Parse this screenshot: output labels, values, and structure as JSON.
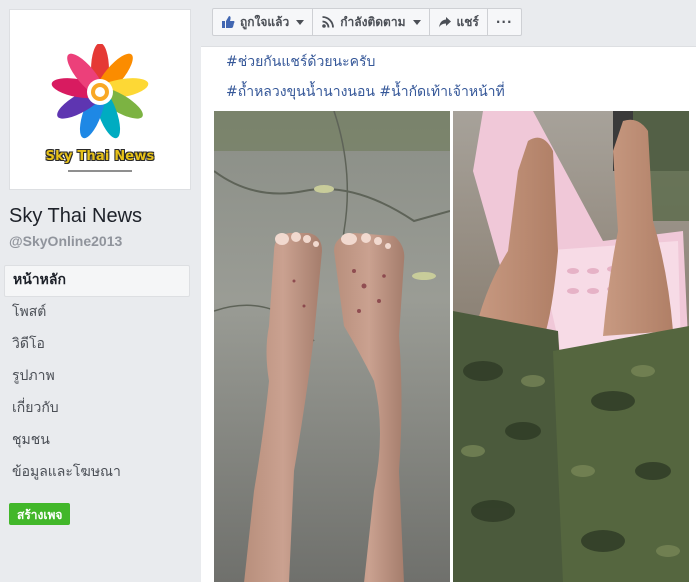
{
  "sidebar": {
    "logo_text": "Sky Thai News",
    "page_name": "Sky Thai News",
    "page_handle": "@SkyOnline2013",
    "nav_items": [
      {
        "label": "หน้าหลัก",
        "active": true
      },
      {
        "label": "โพสต์",
        "active": false
      },
      {
        "label": "วิดีโอ",
        "active": false
      },
      {
        "label": "รูปภาพ",
        "active": false
      },
      {
        "label": "เกี่ยวกับ",
        "active": false
      },
      {
        "label": "ชุมชน",
        "active": false
      },
      {
        "label": "ข้อมูลและโฆษณา",
        "active": false
      }
    ],
    "create_page_label": "สร้างเพจ"
  },
  "toolbar": {
    "like_label": "ถูกใจแล้ว",
    "follow_label": "กำลังติดตาม",
    "share_label": "แชร์",
    "more_label": "···"
  },
  "post": {
    "line1": "#ช่วยกันแชร์ด้วยนะครับ",
    "line2": "#ถ้ำหลวงขุนน้ำนางนอน #น้ำกัดเท้าเจ้าหน้าที่",
    "photos": [
      {
        "name": "photo-feet-on-pavement"
      },
      {
        "name": "photo-feet-on-plastic-chair"
      }
    ]
  },
  "colors": {
    "link": "#365899",
    "create_button": "#42b72a",
    "like_icon": "#4267b2",
    "logo_text": "#e7c21a"
  }
}
